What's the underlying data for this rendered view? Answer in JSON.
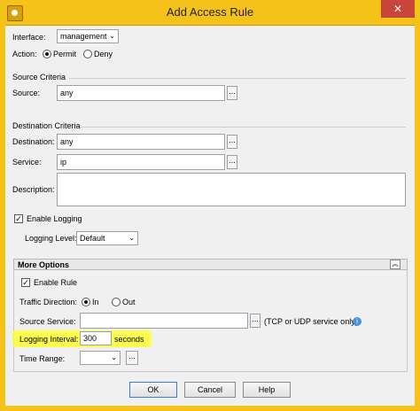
{
  "window": {
    "title": "Add Access Rule"
  },
  "interface": {
    "label": "Interface:",
    "value": "management"
  },
  "action": {
    "label": "Action:",
    "permit": "Permit",
    "deny": "Deny",
    "selected": "Permit"
  },
  "source_criteria": {
    "heading": "Source Criteria",
    "source_label": "Source:",
    "source_value": "any"
  },
  "destination_criteria": {
    "heading": "Destination Criteria",
    "destination_label": "Destination:",
    "destination_value": "any",
    "service_label": "Service:",
    "service_value": "ip"
  },
  "description": {
    "label": "Description:",
    "value": ""
  },
  "logging": {
    "enable_label": "Enable Logging",
    "enabled": true,
    "level_label": "Logging Level:",
    "level_value": "Default"
  },
  "more_options": {
    "heading": "More Options",
    "enable_rule_label": "Enable Rule",
    "enable_rule_checked": true,
    "traffic_direction_label": "Traffic Direction:",
    "direction_in": "In",
    "direction_out": "Out",
    "direction_selected": "In",
    "source_service_label": "Source Service:",
    "source_service_value": "",
    "source_service_hint": "(TCP or UDP service only)",
    "logging_interval_label": "Logging Interval:",
    "logging_interval_value": "300",
    "logging_interval_unit": "seconds",
    "time_range_label": "Time Range:",
    "time_range_value": ""
  },
  "buttons": {
    "ok": "OK",
    "cancel": "Cancel",
    "help": "Help"
  },
  "colors": {
    "titlebar": "#f5c21a",
    "highlight": "#ffff33"
  }
}
